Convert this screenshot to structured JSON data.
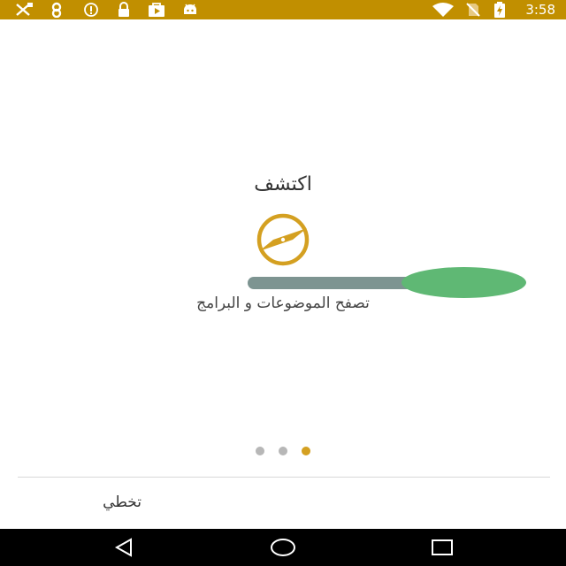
{
  "status_bar": {
    "time": "3:58",
    "left_icons": [
      "satellite-off-icon",
      "alarm-icon",
      "info-icon",
      "lock-icon",
      "play-store-icon",
      "android-icon"
    ],
    "right_icons": [
      "wifi-icon",
      "no-sim-icon",
      "battery-charging-icon"
    ],
    "background_color": "#c18f00"
  },
  "onboarding": {
    "title": "اكتشف",
    "icon": "compass-icon",
    "subtitle": "تصفح الموضوعات و البرامج",
    "accent_color": "#d4a021",
    "current_page": 3,
    "total_pages": 3
  },
  "footer": {
    "skip_label": "تخطي"
  },
  "nav_bar": {
    "buttons": [
      "back-icon",
      "home-icon",
      "recents-icon"
    ]
  }
}
